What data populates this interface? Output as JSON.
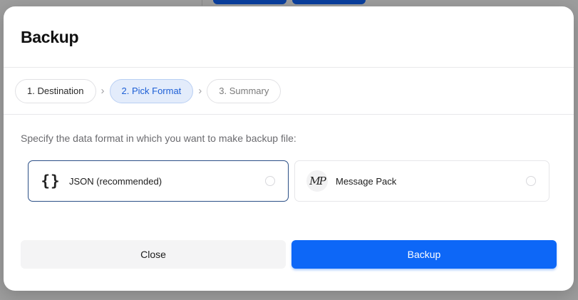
{
  "dialog": {
    "title": "Backup"
  },
  "steps": [
    {
      "label": "1. Destination",
      "state": "done"
    },
    {
      "label": "2. Pick Format",
      "state": "active"
    },
    {
      "label": "3. Summary",
      "state": "pending"
    }
  ],
  "step_separator_icon": "chevron-right-icon",
  "prompt": "Specify the data format in which you want to make backup file:",
  "formats": [
    {
      "label": "JSON (recommended)",
      "icon": "curly-braces-icon",
      "icon_text": "{}",
      "selected": true
    },
    {
      "label": "Message Pack",
      "icon": "messagepack-logo-icon",
      "icon_text": "MP",
      "selected": false
    }
  ],
  "buttons": {
    "close_label": "Close",
    "backup_label": "Backup"
  },
  "colors": {
    "accent": "#0d67f7",
    "active_step_bg": "#e3ecfb",
    "active_step_text": "#1d5fd6",
    "selected_border": "#2b4f86"
  }
}
